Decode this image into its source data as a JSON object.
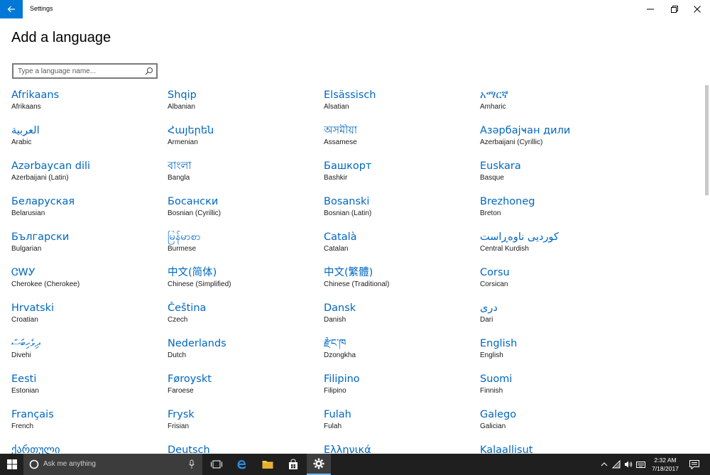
{
  "window": {
    "title": "Settings"
  },
  "page": {
    "title": "Add a language"
  },
  "search": {
    "placeholder": "Type a language name..."
  },
  "languages": [
    {
      "native": "Afrikaans",
      "english": "Afrikaans"
    },
    {
      "native": "Shqip",
      "english": "Albanian"
    },
    {
      "native": "Elsässisch",
      "english": "Alsatian"
    },
    {
      "native": "አማርኛ",
      "english": "Amharic"
    },
    {
      "native": "العربية",
      "english": "Arabic"
    },
    {
      "native": "Հայերեն",
      "english": "Armenian"
    },
    {
      "native": "অসমীয়া",
      "english": "Assamese"
    },
    {
      "native": "Азәрбајҹан дили",
      "english": "Azerbaijani (Cyrillic)"
    },
    {
      "native": "Azərbaycan dili",
      "english": "Azerbaijani (Latin)"
    },
    {
      "native": "বাংলা",
      "english": "Bangla"
    },
    {
      "native": "Башкорт",
      "english": "Bashkir"
    },
    {
      "native": "Euskara",
      "english": "Basque"
    },
    {
      "native": "Беларуская",
      "english": "Belarusian"
    },
    {
      "native": "Босански",
      "english": "Bosnian (Cyrillic)"
    },
    {
      "native": "Bosanski",
      "english": "Bosnian (Latin)"
    },
    {
      "native": "Brezhoneg",
      "english": "Breton"
    },
    {
      "native": "Български",
      "english": "Bulgarian"
    },
    {
      "native": "မြန်မာစာ",
      "english": "Burmese"
    },
    {
      "native": "Català",
      "english": "Catalan"
    },
    {
      "native": "کوردیی ناوەڕاست",
      "english": "Central Kurdish"
    },
    {
      "native": "ᏣᎳᎩ",
      "english": "Cherokee (Cherokee)"
    },
    {
      "native": "中文(简体)",
      "english": "Chinese (Simplified)"
    },
    {
      "native": "中文(繁體)",
      "english": "Chinese (Traditional)"
    },
    {
      "native": "Corsu",
      "english": "Corsican"
    },
    {
      "native": "Hrvatski",
      "english": "Croatian"
    },
    {
      "native": "Čeština",
      "english": "Czech"
    },
    {
      "native": "Dansk",
      "english": "Danish"
    },
    {
      "native": "دری",
      "english": "Dari"
    },
    {
      "native": "ދިވެހިބަސް",
      "english": "Divehi"
    },
    {
      "native": "Nederlands",
      "english": "Dutch"
    },
    {
      "native": "རྫོང་ཁ",
      "english": "Dzongkha"
    },
    {
      "native": "English",
      "english": "English"
    },
    {
      "native": "Eesti",
      "english": "Estonian"
    },
    {
      "native": "Føroyskt",
      "english": "Faroese"
    },
    {
      "native": "Filipino",
      "english": "Filipino"
    },
    {
      "native": "Suomi",
      "english": "Finnish"
    },
    {
      "native": "Français",
      "english": "French"
    },
    {
      "native": "Frysk",
      "english": "Frisian"
    },
    {
      "native": "Fulah",
      "english": "Fulah"
    },
    {
      "native": "Galego",
      "english": "Galician"
    },
    {
      "native": "ქართული",
      "english": ""
    },
    {
      "native": "Deutsch",
      "english": ""
    },
    {
      "native": "Ελληνικά",
      "english": ""
    },
    {
      "native": "Kalaallisut",
      "english": ""
    }
  ],
  "taskbar": {
    "search_placeholder": "Ask me anything",
    "time": "2:32 AM",
    "date": "7/18/2017"
  },
  "colors": {
    "accent": "#0078d7",
    "link": "#0067c0",
    "taskbar": "#1f1f1f"
  },
  "icons": [
    "back-arrow-icon",
    "minimize-icon",
    "maximize-icon",
    "close-icon",
    "search-icon",
    "windows-logo-icon",
    "cortana-circle-icon",
    "microphone-icon",
    "task-view-icon",
    "edge-icon",
    "file-explorer-icon",
    "store-icon",
    "settings-gear-icon",
    "chevron-up-icon",
    "network-icon",
    "volume-icon",
    "keyboard-icon",
    "notifications-icon"
  ]
}
